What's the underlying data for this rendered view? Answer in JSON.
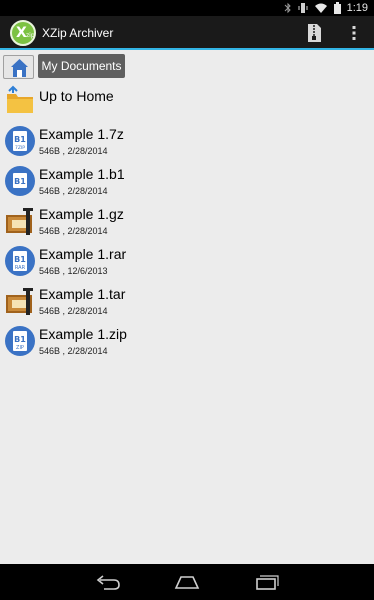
{
  "status_bar": {
    "time": "1:19"
  },
  "app_bar": {
    "title": "XZip Archiver",
    "logo_letter": "X",
    "logo_sub": "zip"
  },
  "breadcrumb": {
    "current": "My Documents"
  },
  "up_label": "Up to Home",
  "files": [
    {
      "name": "Example 1.7z",
      "meta": "546B , 2/28/2014",
      "icon": "archive-disc-icon",
      "badge": "7ZIP"
    },
    {
      "name": "Example 1.b1",
      "meta": "546B , 2/28/2014",
      "icon": "archive-disc-icon",
      "badge": ""
    },
    {
      "name": "Example 1.gz",
      "meta": "546B , 2/28/2014",
      "icon": "archive-box-icon",
      "badge": ""
    },
    {
      "name": "Example 1.rar",
      "meta": "546B , 12/6/2013",
      "icon": "archive-disc-icon",
      "badge": "RAR"
    },
    {
      "name": "Example 1.tar",
      "meta": "546B , 2/28/2014",
      "icon": "archive-box-icon",
      "badge": ""
    },
    {
      "name": "Example 1.zip",
      "meta": "546B , 2/28/2014",
      "icon": "archive-disc-icon",
      "badge": "ZIP"
    }
  ],
  "colors": {
    "accent": "#33b5e5",
    "logo_green": "#7cc242",
    "disc_blue": "#3a72c4",
    "box_brown": "#a0621c"
  }
}
